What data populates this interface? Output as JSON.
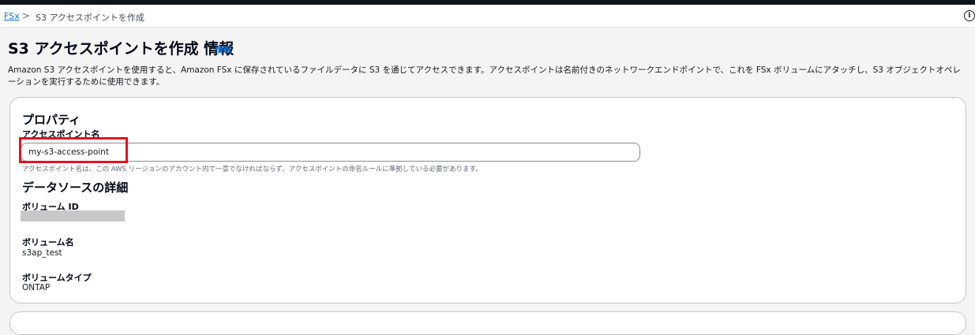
{
  "breadcrumb": {
    "root": "FSx",
    "separator": ">",
    "current": "S3 アクセスポイントを作成"
  },
  "help_icon": "info-circle-icon",
  "header": {
    "title": "S3 アクセスポイントを作成 情報",
    "info_link": "情報",
    "description": "Amazon S3 アクセスポイントを使用すると、Amazon FSx に保存されているファイルデータに S3 を通じてアクセスできます。アクセスポイントは名前付きのネットワークエンドポイントで、これを FSx ボリュームにアタッチし、S3 オブジェクトオペレーションを実行するために使用できます。"
  },
  "properties": {
    "title": "プロパティ",
    "name_label": "アクセスポイント名",
    "name_value": "my-s3-access-point",
    "name_help": "アクセスポイント名は、この AWS リージョンのアカウント内で一意でなければならず、アクセスポイントの命名ルールに準拠している必要があります。"
  },
  "data_source": {
    "title": "データソースの詳細",
    "volume_id_label": "ボリューム ID",
    "volume_name_label": "ボリューム名",
    "volume_name_value": "s3ap_test",
    "volume_type_label": "ボリュームタイプ",
    "volume_type_value": "ONTAP"
  },
  "colors": {
    "link": "#0972d3",
    "highlight": "#e2141f",
    "panel_border": "#c6c6cd"
  }
}
